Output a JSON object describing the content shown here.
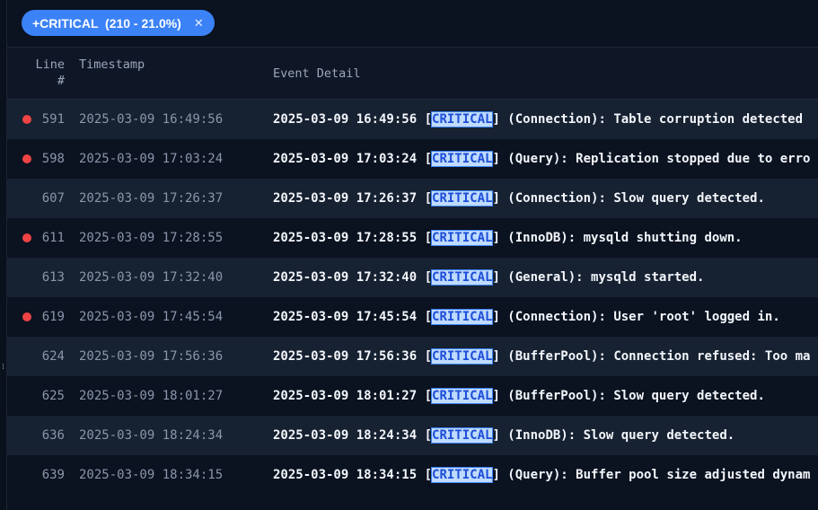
{
  "filter": {
    "chip_label": "+CRITICAL  (210 - 21.0%)",
    "close_glyph": "✕"
  },
  "columns": {
    "line": "Line #",
    "timestamp": "Timestamp",
    "detail": "Event Detail"
  },
  "highlight_term": "CRITICAL",
  "colors": {
    "chip": "#3b82f6",
    "marker": "#ef4444",
    "highlight_bg": "#bfdbfe",
    "highlight_text": "#1d4ed8"
  },
  "rows": [
    {
      "marked": true,
      "line": "591",
      "timestamp": "2025-03-09 16:49:56",
      "pre": "2025-03-09 16:49:56 [",
      "level": "CRITICAL",
      "post": "] (Connection): Table corruption detected"
    },
    {
      "marked": true,
      "line": "598",
      "timestamp": "2025-03-09 17:03:24",
      "pre": "2025-03-09 17:03:24 [",
      "level": "CRITICAL",
      "post": "] (Query): Replication stopped due to erro"
    },
    {
      "marked": false,
      "line": "607",
      "timestamp": "2025-03-09 17:26:37",
      "pre": "2025-03-09 17:26:37 [",
      "level": "CRITICAL",
      "post": "] (Connection): Slow query detected."
    },
    {
      "marked": true,
      "line": "611",
      "timestamp": "2025-03-09 17:28:55",
      "pre": "2025-03-09 17:28:55 [",
      "level": "CRITICAL",
      "post": "] (InnoDB): mysqld shutting down."
    },
    {
      "marked": false,
      "line": "613",
      "timestamp": "2025-03-09 17:32:40",
      "pre": "2025-03-09 17:32:40 [",
      "level": "CRITICAL",
      "post": "] (General): mysqld started."
    },
    {
      "marked": true,
      "line": "619",
      "timestamp": "2025-03-09 17:45:54",
      "pre": "2025-03-09 17:45:54 [",
      "level": "CRITICAL",
      "post": "] (Connection): User 'root' logged in."
    },
    {
      "marked": false,
      "line": "624",
      "timestamp": "2025-03-09 17:56:36",
      "pre": "2025-03-09 17:56:36 [",
      "level": "CRITICAL",
      "post": "] (BufferPool): Connection refused: Too ma"
    },
    {
      "marked": false,
      "line": "625",
      "timestamp": "2025-03-09 18:01:27",
      "pre": "2025-03-09 18:01:27 [",
      "level": "CRITICAL",
      "post": "] (BufferPool): Slow query detected."
    },
    {
      "marked": false,
      "line": "636",
      "timestamp": "2025-03-09 18:24:34",
      "pre": "2025-03-09 18:24:34 [",
      "level": "CRITICAL",
      "post": "] (InnoDB): Slow query detected."
    },
    {
      "marked": false,
      "line": "639",
      "timestamp": "2025-03-09 18:34:15",
      "pre": "2025-03-09 18:34:15 [",
      "level": "CRITICAL",
      "post": "] (Query): Buffer pool size adjusted dynam"
    }
  ]
}
